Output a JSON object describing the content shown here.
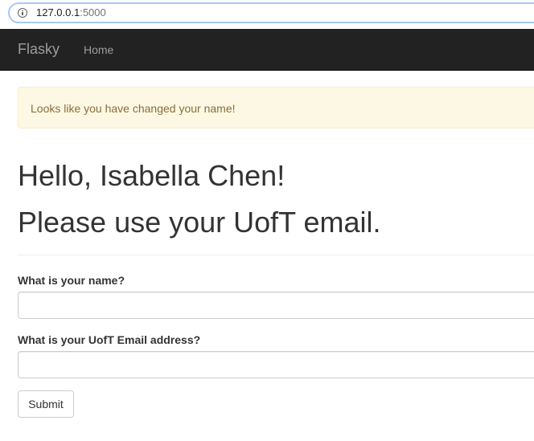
{
  "browser": {
    "url_host": "127.0.0.1",
    "url_port": ":5000",
    "info_icon": "info-icon"
  },
  "navbar": {
    "brand": "Flasky",
    "links": [
      {
        "label": "Home"
      }
    ]
  },
  "alert": {
    "message": "Looks like you have changed your name!"
  },
  "main": {
    "greeting": "Hello, Isabella Chen!",
    "instruction": "Please use your UofT email."
  },
  "form": {
    "name_label": "What is your name?",
    "name_value": "",
    "email_label": "What is your UofT Email address?",
    "email_value": "",
    "submit_label": "Submit"
  },
  "colors": {
    "navbar_bg": "#222222",
    "alert_bg": "#fcf8e3",
    "alert_text": "#8a6d3b"
  }
}
